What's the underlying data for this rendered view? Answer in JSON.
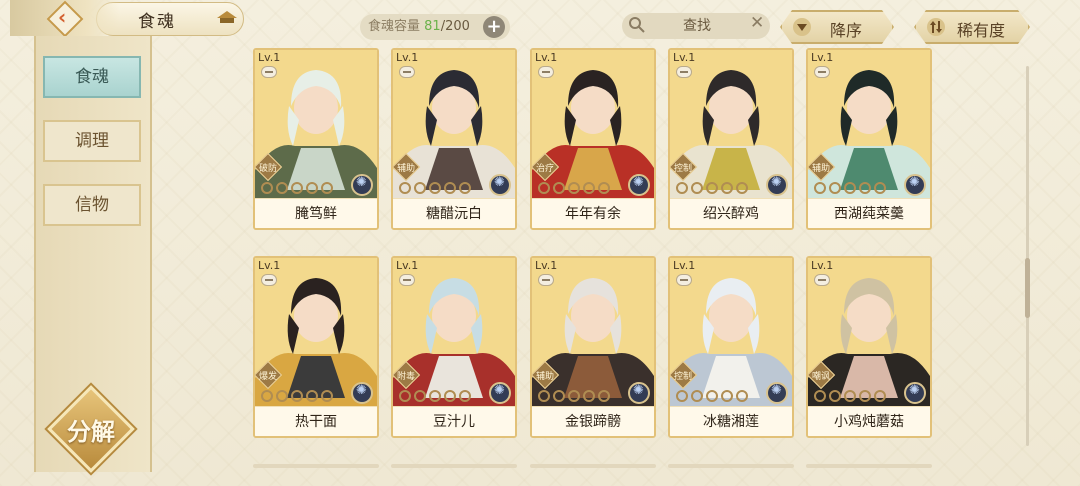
{
  "header": {
    "title": "食魂",
    "capacity_label": "食魂容量",
    "capacity_current": "81",
    "capacity_max": "/200",
    "add_icon": "plus-icon",
    "search_label": "查找",
    "sort_order_label": "降序",
    "sort_key_label": "稀有度"
  },
  "sidebar": {
    "tabs": [
      {
        "label": "食魂",
        "active": true
      },
      {
        "label": "调理",
        "active": false
      },
      {
        "label": "信物",
        "active": false
      }
    ],
    "decompose_label": "分解"
  },
  "cards": [
    {
      "level": "Lv.1",
      "role": "破防",
      "name": "腌笃鲜",
      "stars": 0,
      "palette": [
        "#f3d98d",
        "#e7efe7",
        "#5d6b4a",
        "#c9d6c8"
      ]
    },
    {
      "level": "Lv.1",
      "role": "辅助",
      "name": "糖醋沅白",
      "stars": 0,
      "palette": [
        "#f3d98d",
        "#2b2b33",
        "#e8e2d6",
        "#5a4a44"
      ]
    },
    {
      "level": "Lv.1",
      "role": "治疗",
      "name": "年年有余",
      "stars": 0,
      "palette": [
        "#f3d98d",
        "#2a2322",
        "#b93026",
        "#d8a64a"
      ]
    },
    {
      "level": "Lv.1",
      "role": "控制",
      "name": "绍兴醉鸡",
      "stars": 0,
      "palette": [
        "#f3d98d",
        "#2e2a2a",
        "#e9e3cf",
        "#c8b449"
      ]
    },
    {
      "level": "Lv.1",
      "role": "辅助",
      "name": "西湖莼菜羹",
      "stars": 0,
      "palette": [
        "#f3d98d",
        "#1f2a28",
        "#cfe6dc",
        "#4e8a6f"
      ]
    },
    {
      "level": "Lv.1",
      "role": "爆发",
      "name": "热干面",
      "stars": 0,
      "palette": [
        "#f3d98d",
        "#2a2220",
        "#d9a742",
        "#3b3b3b"
      ]
    },
    {
      "level": "Lv.1",
      "role": "附毒",
      "name": "豆汁儿",
      "stars": 0,
      "palette": [
        "#f3d98d",
        "#c7dde4",
        "#a8302b",
        "#e9e4dc"
      ]
    },
    {
      "level": "Lv.1",
      "role": "辅助",
      "name": "金银蹄髈",
      "stars": 0,
      "palette": [
        "#f3d98d",
        "#e6e2dc",
        "#3a302c",
        "#8c5b3a"
      ]
    },
    {
      "level": "Lv.1",
      "role": "控制",
      "name": "冰糖湘莲",
      "stars": 0,
      "palette": [
        "#f3d98d",
        "#e9eef2",
        "#bcc7d3",
        "#f2f1ec"
      ]
    },
    {
      "level": "Lv.1",
      "role": "嘲讽",
      "name": "小鸡炖蘑菇",
      "stars": 0,
      "palette": [
        "#f3d98d",
        "#cfc2a2",
        "#2b2723",
        "#d9b8a8"
      ]
    }
  ]
}
